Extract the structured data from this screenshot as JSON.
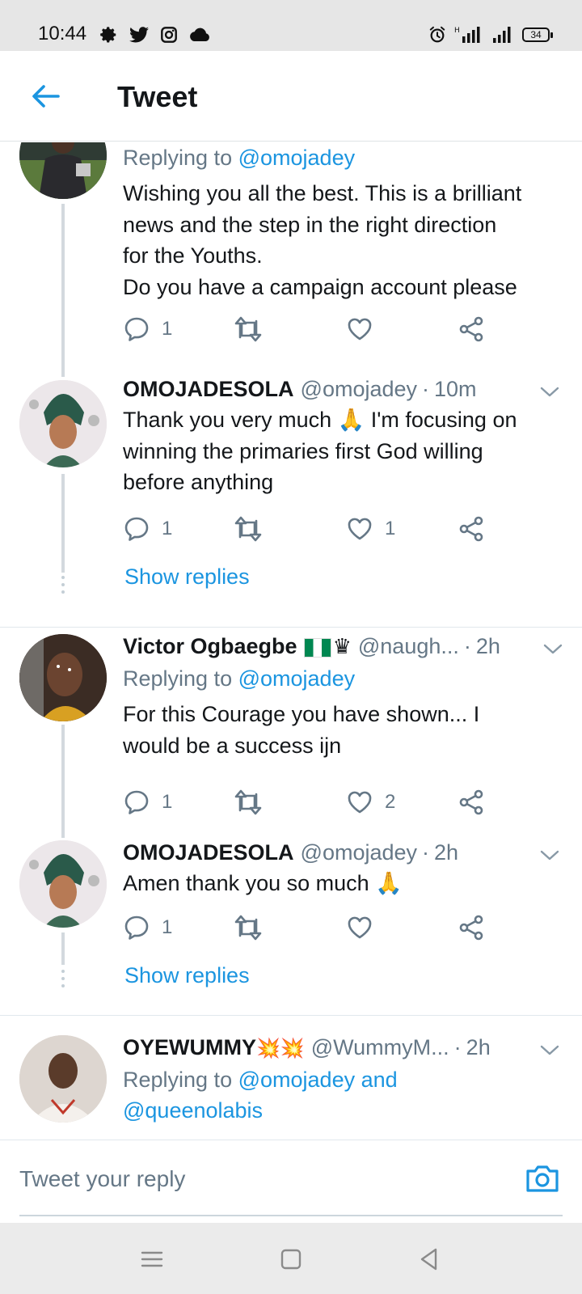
{
  "status_bar": {
    "time": "10:44",
    "battery": "34",
    "icons": [
      "settings-gear-icon",
      "twitter-icon",
      "instagram-icon",
      "cloud-icon",
      "alarm-icon",
      "signal-icon",
      "signal-icon",
      "battery-icon"
    ]
  },
  "header": {
    "title": "Tweet",
    "back_icon": "arrow-left-icon"
  },
  "colors": {
    "accent": "#1b95e0",
    "secondary_text": "#657786",
    "primary_text": "#14171a",
    "thread_line": "#d3d9de"
  },
  "tweets": [
    {
      "reply_prefix": "Replying to",
      "reply_to": "@omojadey",
      "lines": [
        "Wishing you all the best. This is a brilliant",
        "news and the step in the right direction",
        "for the Youths.",
        "Do you have a campaign account please"
      ],
      "replies": "1",
      "likes": ""
    },
    {
      "name": "OMOJADESOLA",
      "handle": "@omojadey",
      "sep": "·",
      "time": "10m",
      "lines": [
        "Thank you very much 🙏 I'm focusing on",
        "winning the primaries first God willing",
        "before anything"
      ],
      "replies": "1",
      "likes": "1",
      "show_replies": "Show replies"
    },
    {
      "name": "Victor Ogbaegbe",
      "name_emoji": "♛",
      "handle": "@naugh...",
      "sep": "·",
      "time": "2h",
      "reply_prefix": "Replying to",
      "reply_to": "@omojadey",
      "lines": [
        "For this Courage you have shown... I",
        "would be a success ijn"
      ],
      "replies": "1",
      "likes": "2"
    },
    {
      "name": "OMOJADESOLA",
      "handle": "@omojadey",
      "sep": "·",
      "time": "2h",
      "lines": [
        "Amen thank you so much 🙏"
      ],
      "replies": "1",
      "likes": "",
      "show_replies": "Show replies"
    },
    {
      "name": "OYEWUMMY",
      "name_emoji": "💥💥",
      "handle": "@WummyM...",
      "sep": "·",
      "time": "2h",
      "reply_prefix": "Replying to",
      "reply_line1": "@omojadey and",
      "reply_line2": "@queenolabis"
    }
  ],
  "composer": {
    "placeholder": "Tweet your reply",
    "camera_icon": "camera-icon"
  },
  "navbar": {
    "icons": [
      "menu-icon",
      "home-square-icon",
      "back-triangle-icon"
    ]
  }
}
